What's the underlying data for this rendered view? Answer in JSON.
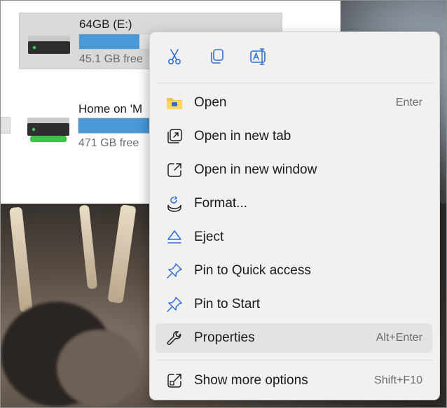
{
  "colors": {
    "accent_blue": "#2b6fd6",
    "drive_bar_fill": "#4a9ad8",
    "menu_background": "#f3f1ef",
    "menu_hover": "#e5e3e1",
    "folder_yellow": "#f2c744"
  },
  "explorer": {
    "drives": [
      {
        "name": "64GB (E:)",
        "free_text": "45.1 GB free",
        "used_fraction": 0.3,
        "icon": "usb-drive-icon",
        "selected": true
      },
      {
        "name": "Home on 'M",
        "free_text": "471 GB free",
        "used_fraction": 0.45,
        "icon": "network-drive-icon",
        "selected": false
      }
    ]
  },
  "context_menu": {
    "toolbar": [
      {
        "icon": "cut-icon"
      },
      {
        "icon": "copy-icon"
      },
      {
        "icon": "rename-icon"
      }
    ],
    "items": [
      {
        "label": "Open",
        "shortcut": "Enter",
        "icon": "folder-icon"
      },
      {
        "label": "Open in new tab",
        "shortcut": "",
        "icon": "new-tab-icon"
      },
      {
        "label": "Open in new window",
        "shortcut": "",
        "icon": "new-window-icon"
      },
      {
        "label": "Format...",
        "shortcut": "",
        "icon": "format-icon"
      },
      {
        "label": "Eject",
        "shortcut": "",
        "icon": "eject-icon"
      },
      {
        "label": "Pin to Quick access",
        "shortcut": "",
        "icon": "pin-icon"
      },
      {
        "label": "Pin to Start",
        "shortcut": "",
        "icon": "pin-icon"
      },
      {
        "label": "Properties",
        "shortcut": "Alt+Enter",
        "icon": "wrench-icon",
        "hovered": true
      },
      {
        "label": "Show more options",
        "shortcut": "Shift+F10",
        "icon": "more-options-icon"
      }
    ]
  }
}
